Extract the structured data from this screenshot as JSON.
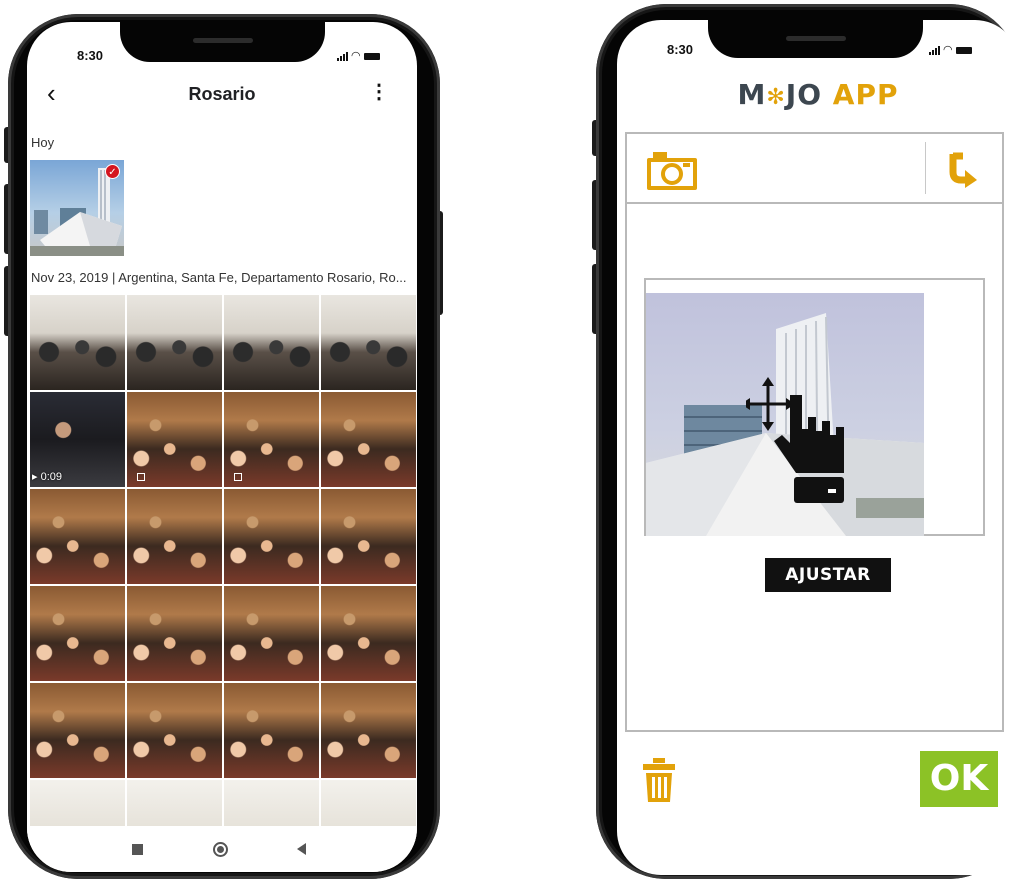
{
  "left_phone": {
    "status_time": "8:30",
    "header": {
      "back_icon": "chevron-left-icon",
      "title": "Rosario",
      "more_icon": "more-vertical-icon"
    },
    "section_today": "Hoy",
    "featured_selected": true,
    "date_location": "Nov 23, 2019 | Argentina, Santa Fe, Departamento Rosario, Ro...",
    "video_duration": "0:09",
    "nav_icons": [
      "recents-square-icon",
      "home-circle-icon",
      "back-triangle-icon"
    ]
  },
  "right_phone": {
    "status_time": "8:30",
    "logo": {
      "m": "M",
      "gear": "✻",
      "jo": "JO",
      "app": "APP"
    },
    "toolbar": {
      "camera_icon": "camera-icon",
      "rotate_icon": "rotate-icon"
    },
    "adjust_label": "AJUSTAR",
    "trash_icon": "trash-icon",
    "ok_label": "OK",
    "colors": {
      "accent_orange": "#e2a20a",
      "ok_green": "#8cc226",
      "logo_dark": "#3d4750"
    }
  }
}
